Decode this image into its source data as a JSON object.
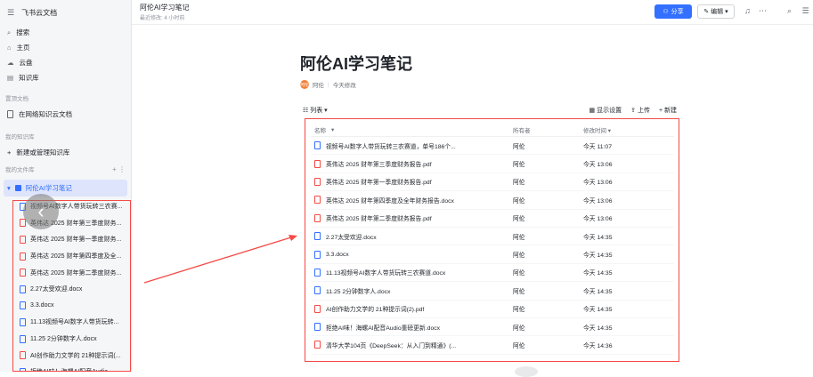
{
  "sidebar": {
    "app_title": "飞书云文档",
    "search": "搜索",
    "nav": [
      "主页",
      "云盘",
      "知识库"
    ],
    "recent_label": "置顶文档",
    "recent_item": "在网络知识云文档",
    "kb_label": "我的知识库",
    "new_kb": "新建或管理知识库",
    "my_docs_label": "我的文件库",
    "kb_name": "阿伦AI学习笔记",
    "files": [
      {
        "name": "视频号AI数字人带货玩转三农赛...",
        "type": "doc"
      },
      {
        "name": "英伟达 2025 财年第三季度财务...",
        "type": "pdf"
      },
      {
        "name": "英伟达 2025 财年第一季度财务...",
        "type": "pdf"
      },
      {
        "name": "英伟达 2025 财年第四季度及全...",
        "type": "pdf"
      },
      {
        "name": "英伟达 2025 财年第二季度财务...",
        "type": "pdf"
      },
      {
        "name": "2.27太受欢迎.docx",
        "type": "doc"
      },
      {
        "name": "3.3.docx",
        "type": "doc"
      },
      {
        "name": "11.13视频号AI数字人带货玩转...",
        "type": "doc"
      },
      {
        "name": "11.25 2分钟数字人.docx",
        "type": "doc"
      },
      {
        "name": "AI创作助力文学的 21种提示词(...",
        "type": "pdf"
      },
      {
        "name": "拒绝AI味！海螺AI配音Audio...",
        "type": "doc"
      }
    ]
  },
  "header": {
    "title": "阿伦AI学习笔记",
    "subtitle": "最近修改: 4 小时前",
    "share": "分享",
    "edit": "编辑"
  },
  "page": {
    "title": "阿伦AI学习笔记",
    "author": "阿伦",
    "modified": "今天修改",
    "avatar_text": "阿伦"
  },
  "toolbar": {
    "view": "列表",
    "display_settings": "显示设置",
    "upload": "上传",
    "new": "新建"
  },
  "table": {
    "headers": [
      "名称",
      "所有者",
      "修改时间"
    ],
    "rows": [
      {
        "name": "视频号AI数字人带货玩转三农赛道，单号186个...",
        "owner": "阿伦",
        "time": "今天 11:07",
        "type": "doc"
      },
      {
        "name": "英伟达 2025 财年第三季度财务报告.pdf",
        "owner": "阿伦",
        "time": "今天 13:06",
        "type": "pdf"
      },
      {
        "name": "英伟达 2025 财年第一季度财务报告.pdf",
        "owner": "阿伦",
        "time": "今天 13:06",
        "type": "pdf"
      },
      {
        "name": "英伟达 2025 财年第四季度及全年财务报告.docx",
        "owner": "阿伦",
        "time": "今天 13:06",
        "type": "pdf"
      },
      {
        "name": "英伟达 2025 财年第二季度财务报告.pdf",
        "owner": "阿伦",
        "time": "今天 13:06",
        "type": "pdf"
      },
      {
        "name": "2.27太受欢迎.docx",
        "owner": "阿伦",
        "time": "今天 14:35",
        "type": "doc"
      },
      {
        "name": "3.3.docx",
        "owner": "阿伦",
        "time": "今天 14:35",
        "type": "doc"
      },
      {
        "name": "11.13视频号AI数字人带货玩转三农赛道.docx",
        "owner": "阿伦",
        "time": "今天 14:35",
        "type": "doc"
      },
      {
        "name": "11.25 2分钟数字人.docx",
        "owner": "阿伦",
        "time": "今天 14:35",
        "type": "doc"
      },
      {
        "name": "AI创作助力文学的 21种提示词(2).pdf",
        "owner": "阿伦",
        "time": "今天 14:35",
        "type": "pdf"
      },
      {
        "name": "拒绝AI味！海螺AI配音Audio重磅更新.docx",
        "owner": "阿伦",
        "time": "今天 14:35",
        "type": "doc"
      },
      {
        "name": "清华大学104页《DeepSeek：从入门到精通》(...",
        "owner": "阿伦",
        "time": "今天 14:36",
        "type": "pdf"
      }
    ]
  },
  "colors": {
    "accent": "#3370ff",
    "annotation": "#f54a45"
  }
}
